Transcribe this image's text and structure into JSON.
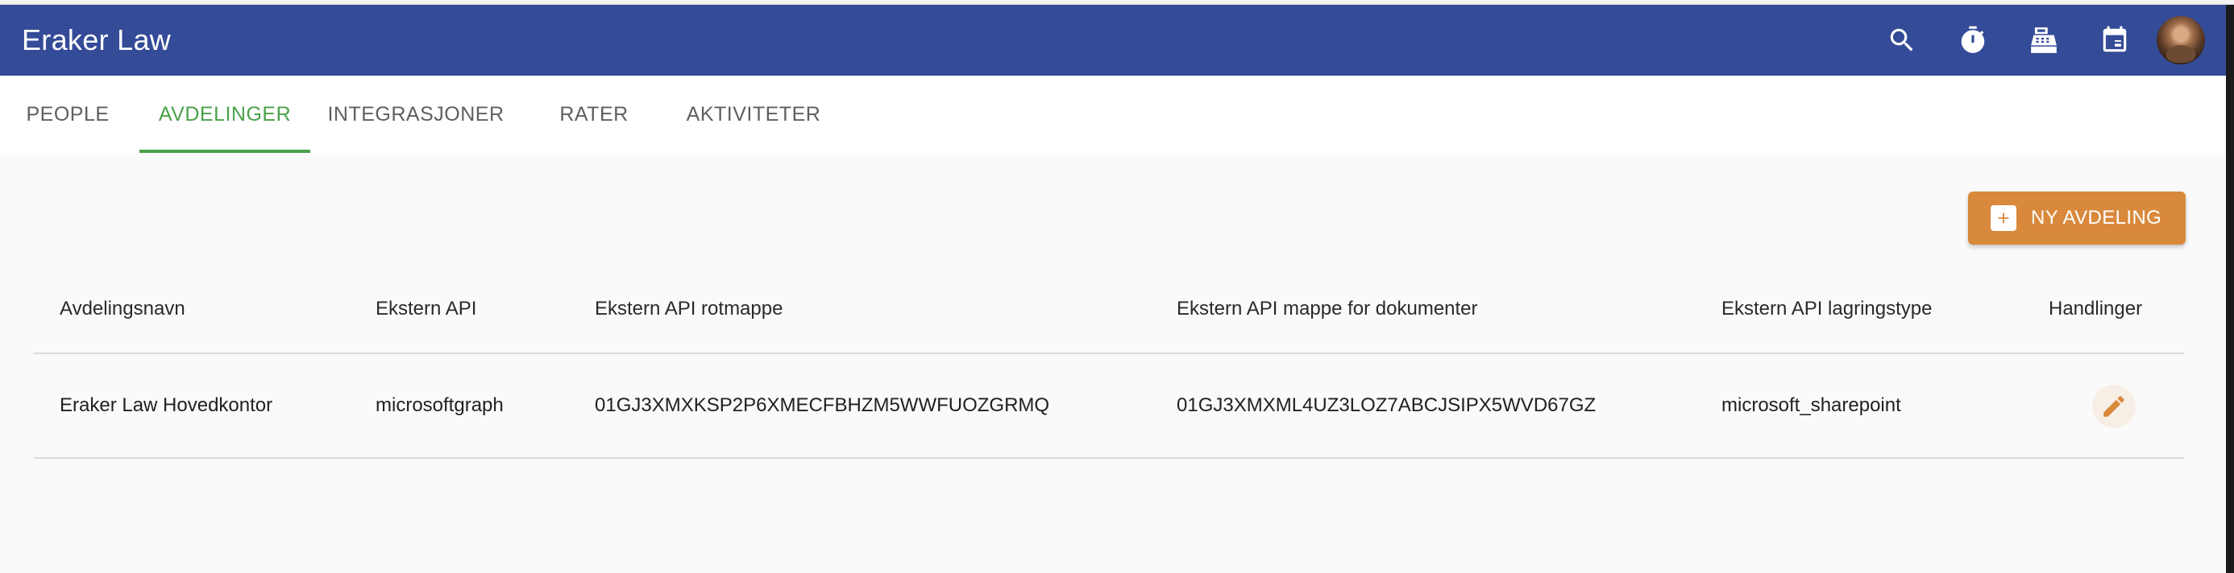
{
  "app": {
    "title": "Eraker Law"
  },
  "appbar": {
    "icons": [
      "search-icon",
      "timer-icon",
      "cash-register-icon",
      "calendar-icon"
    ],
    "avatar": "user-avatar"
  },
  "tabs": [
    {
      "label": "PEOPLE",
      "active": false
    },
    {
      "label": "AVDELINGER",
      "active": true
    },
    {
      "label": "INTEGRASJONER",
      "active": false
    },
    {
      "label": "RATER",
      "active": false
    },
    {
      "label": "AKTIVITETER",
      "active": false
    }
  ],
  "actions": {
    "new_department_label": "NY AVDELING"
  },
  "table": {
    "columns": [
      "Avdelingsnavn",
      "Ekstern API",
      "Ekstern API rotmappe",
      "Ekstern API mappe for dokumenter",
      "Ekstern API lagringstype",
      "Handlinger"
    ],
    "rows": [
      [
        "Eraker Law Hovedkontor",
        "microsoftgraph",
        "01GJ3XMXKSP2P6XMECFBHZM5WWFUOZGRMQ",
        "01GJ3XMXML4UZ3LOZ7ABCJSIPX5WVD67GZ",
        "microsoft_sharepoint"
      ]
    ]
  },
  "colors": {
    "appbar": "#344b97",
    "accent_green": "#4aa14a",
    "accent_orange": "#d9893c"
  }
}
